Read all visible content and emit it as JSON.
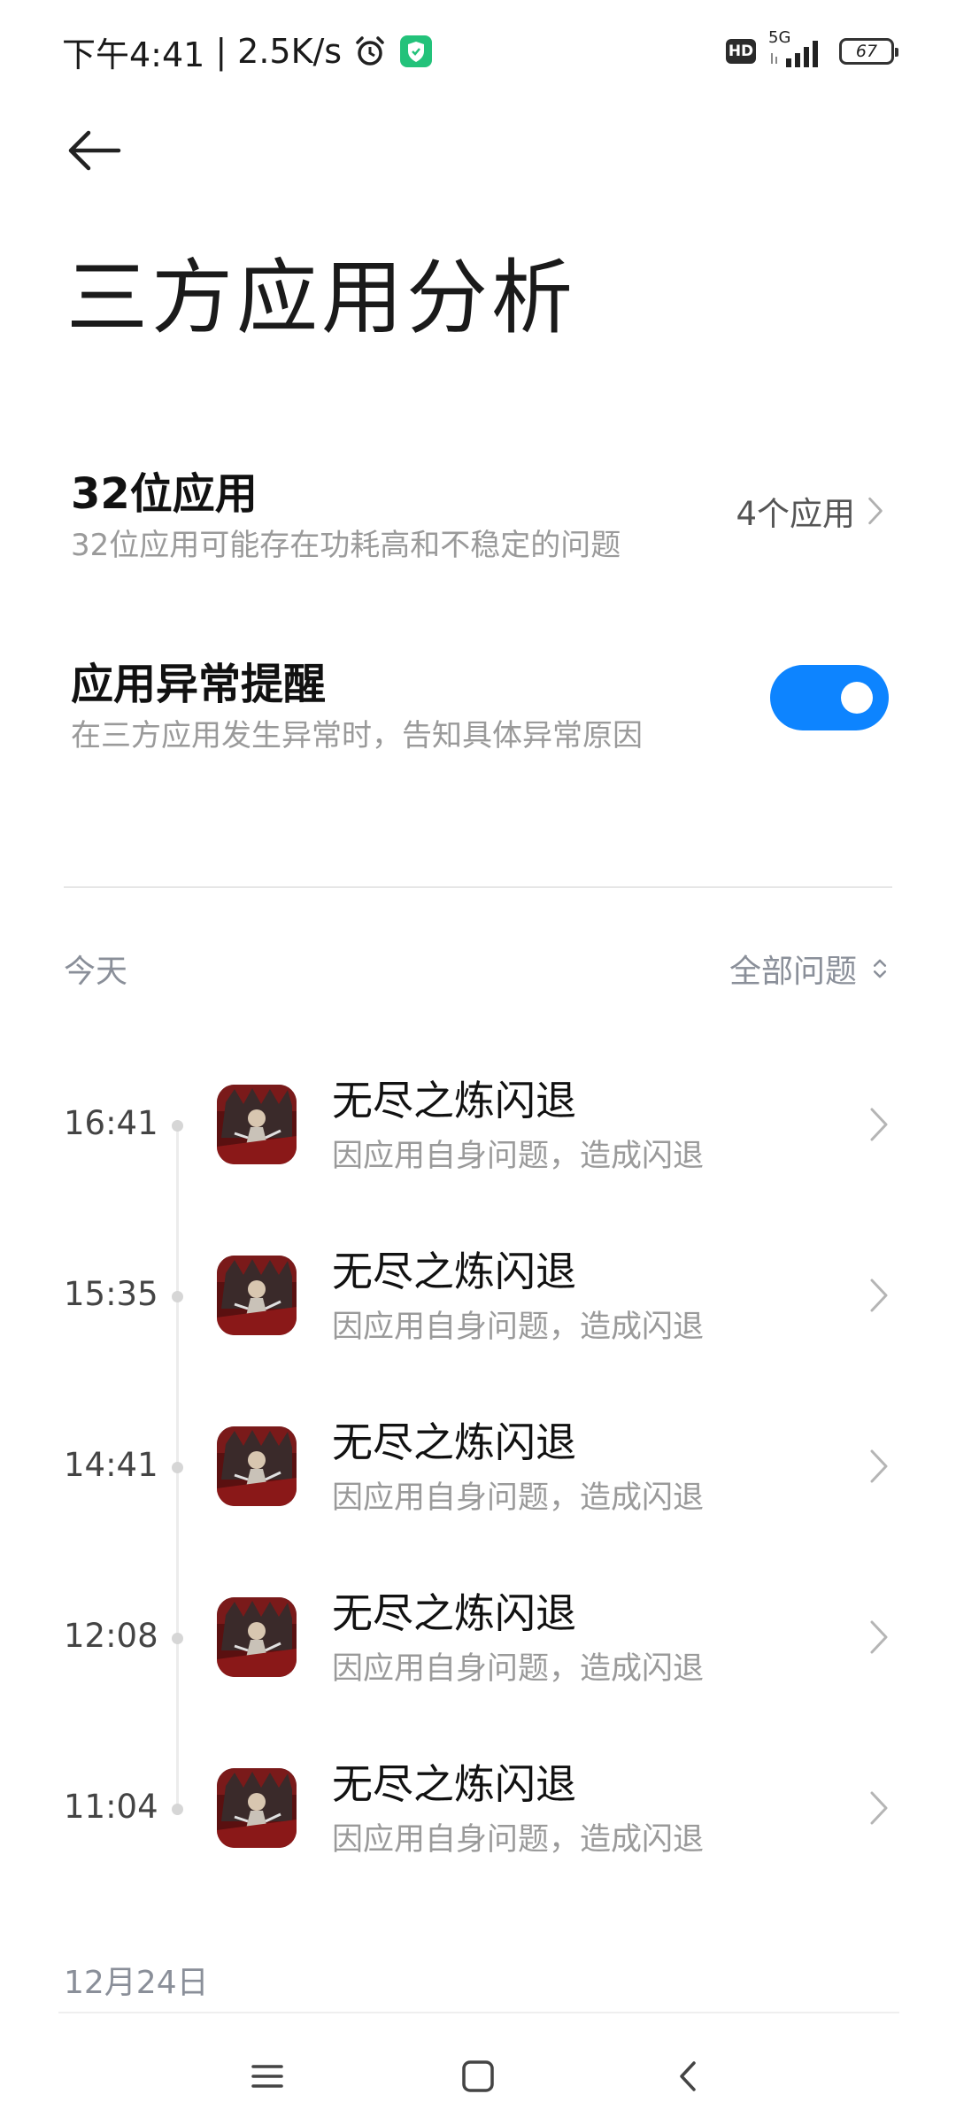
{
  "status_bar": {
    "time": "下午4:41",
    "separator": "|",
    "network_speed": "2.5K/s",
    "hd_label": "HD",
    "signal_label": "5G",
    "battery_level": "67",
    "icons": [
      "alarm-icon",
      "shield-check-icon",
      "hd-icon",
      "signal-icon",
      "battery-icon"
    ]
  },
  "header": {
    "back_icon": "back-arrow-icon",
    "title": "三方应用分析"
  },
  "settings": {
    "apps_32bit": {
      "title": "32位应用",
      "description": "32位应用可能存在功耗高和不稳定的问题",
      "count_label": "4个应用"
    },
    "anomaly_alert": {
      "title": "应用异常提醒",
      "description": "在三方应用发生异常时，告知具体异常原因",
      "enabled": true
    }
  },
  "colors": {
    "toggle_on": "#0d84ff",
    "secondary_text": "#9a9a9a",
    "section_text": "#8a8f99"
  },
  "timeline": {
    "section_today": "今天",
    "filter_label": "全部问题",
    "events": [
      {
        "time": "16:41",
        "title": "无尽之炼闪退",
        "description": "因应用自身问题，造成闪退"
      },
      {
        "time": "15:35",
        "title": "无尽之炼闪退",
        "description": "因应用自身问题，造成闪退"
      },
      {
        "time": "14:41",
        "title": "无尽之炼闪退",
        "description": "因应用自身问题，造成闪退"
      },
      {
        "time": "12:08",
        "title": "无尽之炼闪退",
        "description": "因应用自身问题，造成闪退"
      },
      {
        "time": "11:04",
        "title": "无尽之炼闪退",
        "description": "因应用自身问题，造成闪退"
      }
    ],
    "section_next": "12月24日"
  },
  "nav_bar": {
    "buttons": [
      "menu-icon",
      "home-icon",
      "back-icon"
    ]
  }
}
